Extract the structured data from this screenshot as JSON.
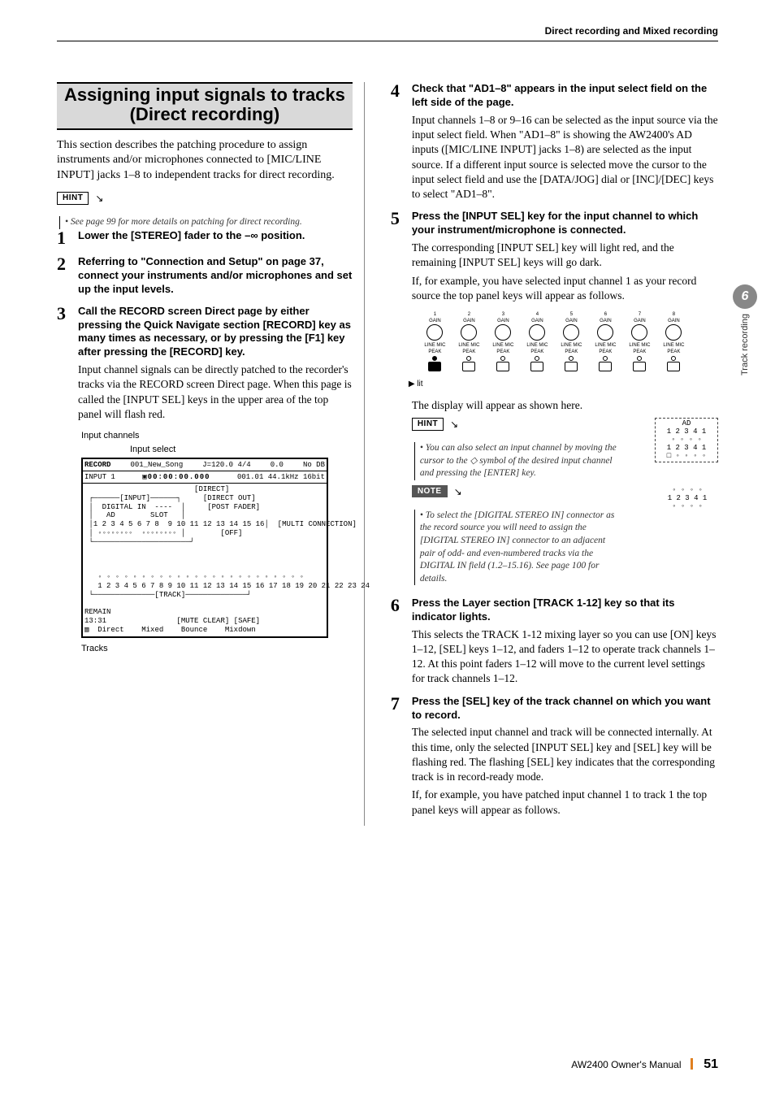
{
  "header": {
    "breadcrumb": "Direct recording and Mixed recording"
  },
  "side": {
    "chapter": "6",
    "label": "Track recording"
  },
  "title": "Assigning input signals to tracks (Direct recording)",
  "intro": "This section describes the patching procedure to assign instruments and/or microphones connected to [MIC/LINE INPUT] jacks 1–8 to independent tracks for direct recording.",
  "hint1": "• See page 99 for more details on patching for direct recording.",
  "steps": {
    "s1_head": "Lower the [STEREO] fader to the –∞ position.",
    "s2_head": "Referring to \"Connection and Setup\" on page 37, connect your instruments and/or microphones and set up the input levels.",
    "s3_head": "Call the RECORD screen Direct page by either pressing the Quick Navigate section [RECORD] key as many times as necessary, or by pressing the [F1] key after pressing the [RECORD] key.",
    "s3_body": "Input channel signals can be directly patched to the recorder's tracks via the RECORD screen Direct page. When this page is called the [INPUT SEL] keys in the upper area of the top panel will flash red.",
    "s4_head": "Check that \"AD1–8\" appears in the input select field on the left side of the page.",
    "s4_body": "Input channels 1–8 or 9–16 can be selected as the input source via the input select field. When \"AD1–8\" is showing the AW2400's AD inputs ([MIC/LINE INPUT] jacks 1–8) are selected as the input source. If a different input source is selected move the cursor to the input select field and use the [DATA/JOG] dial or [INC]/[DEC] keys to select \"AD1–8\".",
    "s5_head": "Press the [INPUT SEL] key for the input channel to which your instrument/microphone is connected.",
    "s5_body1": "The corresponding [INPUT SEL] key will light red, and the remaining [INPUT SEL] keys will go dark.",
    "s5_body2": "If, for example, you have selected input channel 1 as your record source the top panel keys will appear as follows.",
    "s5_after": "The display will appear as shown here.",
    "hint2": "• You can also select an input channel by moving the cursor to the ◇ symbol of the desired input channel and pressing the [ENTER] key.",
    "note1": "• To select the [DIGITAL STEREO IN] connector as the record source you will need to assign the [DIGITAL STEREO IN] connector to an adjacent pair of odd- and even-numbered tracks via the DIGITAL IN field (1.2–15.16). See page 100 for details.",
    "s6_head": "Press the Layer section [TRACK 1-12] key so that its indicator lights.",
    "s6_body": "This selects the TRACK 1-12 mixing layer so you can use [ON] keys 1–12, [SEL] keys 1–12, and faders 1–12 to operate track channels 1–12. At this point faders 1–12 will move to the current level settings for track channels 1–12.",
    "s7_head": "Press the [SEL] key of the track channel on which you want to record.",
    "s7_body1": "The selected input channel and track will be connected internally. At this time, only the selected [INPUT SEL] key and [SEL] key will be flashing red. The flashing [SEL] key indicates that the corresponding track is in record-ready mode.",
    "s7_body2": "If, for example, you have patched input channel 1 to track 1 the top panel keys will appear as follows."
  },
  "fig": {
    "input_channels": "Input channels",
    "input_select": "Input select",
    "tracks": "Tracks",
    "lit": "lit",
    "knob_top": "GAIN",
    "knob_l": "LINE",
    "knob_r": "MIC",
    "knob_peak": "PEAK",
    "mini_ad": "AD\n1 2 3 4 1\n◦ ◦ ◦ ◦\n1 2 3 4 1\n□ ◦ ◦ ◦ ◦",
    "mini_note": "◦ ◦ ◦ ◦\n1 2 3 4 1\n◦ ◦ ◦ ◦"
  },
  "screen": {
    "title_l": "RECORD",
    "title_sub": "INPUT 1",
    "song": "001_New_Song",
    "time": "▣00:00:00.000",
    "tempo": "J=120.0 4/4",
    "meas": "0.0",
    "dB": "No  DB",
    "rate": "001.01 44.1kHz 16bit",
    "direct": "DIRECT",
    "input": "INPUT",
    "digital_in": "DIGITAL IN  ----",
    "ad": "AD",
    "slot": "SLOT",
    "ch_row": "1 2 3 4 5 6 7 8  9 10 11 12 13 14 15 16",
    "direct_out": "DIRECT OUT",
    "post_fader": "POST FADER",
    "multi": "MULTI CONNECTION",
    "off": "OFF",
    "track": "TRACK",
    "track_row": "1 2 3 4 5 6 7 8 9 10 11 12 13 14 15 16 17 18 19 20 21 22 23 24",
    "remain": "REMAIN\n13:31",
    "mute": "MUTE CLEAR",
    "safe": "SAFE",
    "tabs": "Direct    Mixed    Bounce    Mixdown"
  },
  "footer": {
    "manual": "AW2400  Owner's Manual",
    "page": "51"
  }
}
